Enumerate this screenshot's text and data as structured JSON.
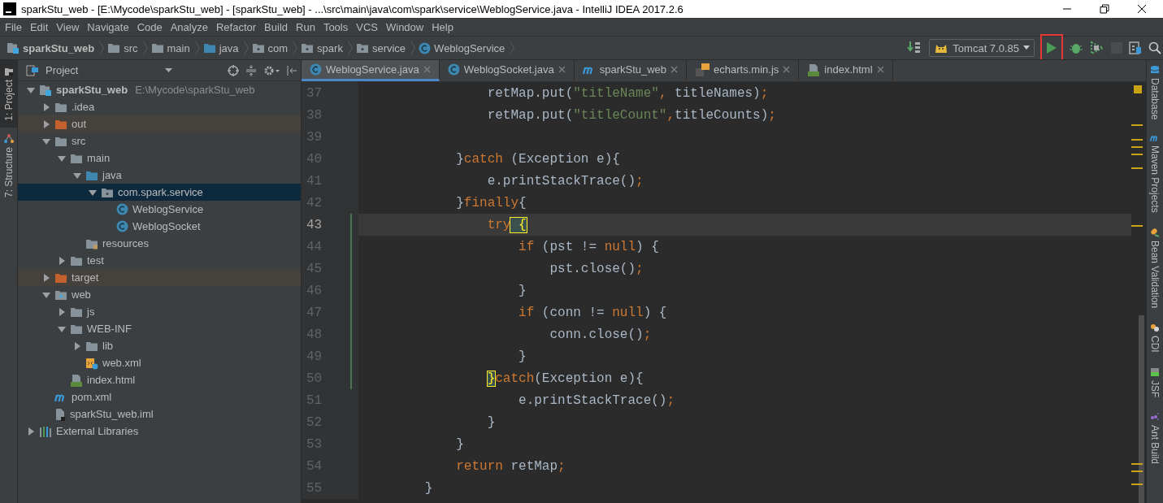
{
  "window": {
    "title": "sparkStu_web - [E:\\Mycode\\sparkStu_web] - [sparkStu_web] - ...\\src\\main\\java\\com\\spark\\service\\WeblogService.java - IntelliJ IDEA 2017.2.6"
  },
  "menu": [
    "File",
    "Edit",
    "View",
    "Navigate",
    "Code",
    "Analyze",
    "Refactor",
    "Build",
    "Run",
    "Tools",
    "VCS",
    "Window",
    "Help"
  ],
  "breadcrumbs": [
    {
      "kind": "module",
      "label": "sparkStu_web"
    },
    {
      "kind": "folder",
      "label": "src"
    },
    {
      "kind": "folder",
      "label": "main"
    },
    {
      "kind": "source",
      "label": "java"
    },
    {
      "kind": "package",
      "label": "com"
    },
    {
      "kind": "package",
      "label": "spark"
    },
    {
      "kind": "package",
      "label": "service"
    },
    {
      "kind": "class",
      "label": "WeblogService"
    }
  ],
  "toolbar": [
    {
      "kind": "update",
      "highlighted": false,
      "disabled": false
    },
    {
      "kind": "config",
      "label": "Tomcat 7.0.85",
      "highlighted": false,
      "disabled": false
    },
    {
      "kind": "run",
      "highlighted": true,
      "disabled": false
    },
    {
      "kind": "debug",
      "highlighted": false,
      "disabled": false
    },
    {
      "kind": "coverage",
      "highlighted": false,
      "disabled": false
    },
    {
      "kind": "stop",
      "highlighted": false,
      "disabled": true
    },
    {
      "kind": "project-structure",
      "highlighted": false,
      "disabled": false
    },
    {
      "kind": "search",
      "highlighted": false,
      "disabled": false
    }
  ],
  "left_tool_windows": [
    {
      "label": "1: Project",
      "selected": true,
      "kind": "project"
    },
    {
      "label": "7: Structure",
      "selected": false,
      "kind": "structure"
    }
  ],
  "project_panel": {
    "title": "Project",
    "tree": [
      {
        "kind": "module",
        "label": "sparkStu_web",
        "path": "E:\\Mycode\\sparkStu_web",
        "expanded": true,
        "selected": false,
        "children": [
          {
            "kind": "folder",
            "label": ".idea",
            "expanded": false,
            "selected": false
          },
          {
            "kind": "excluded",
            "label": "out",
            "expanded": false,
            "selected": false
          },
          {
            "kind": "folder",
            "label": "src",
            "expanded": true,
            "selected": false,
            "children": [
              {
                "kind": "folder",
                "label": "main",
                "expanded": true,
                "selected": false,
                "children": [
                  {
                    "kind": "source",
                    "label": "java",
                    "expanded": true,
                    "selected": false,
                    "children": [
                      {
                        "kind": "package",
                        "label": "com.spark.service",
                        "expanded": true,
                        "selected": true,
                        "children": [
                          {
                            "kind": "class",
                            "label": "WeblogService",
                            "selected": false
                          },
                          {
                            "kind": "class",
                            "label": "WeblogSocket",
                            "selected": false
                          }
                        ]
                      }
                    ]
                  },
                  {
                    "kind": "resources",
                    "label": "resources",
                    "selected": false
                  }
                ]
              },
              {
                "kind": "folder",
                "label": "test",
                "expanded": false,
                "selected": false
              }
            ]
          },
          {
            "kind": "excluded",
            "label": "target",
            "expanded": false,
            "selected": false
          },
          {
            "kind": "web",
            "label": "web",
            "expanded": true,
            "selected": false,
            "children": [
              {
                "kind": "folder",
                "label": "js",
                "expanded": false,
                "selected": false
              },
              {
                "kind": "folder",
                "label": "WEB-INF",
                "expanded": true,
                "selected": false,
                "children": [
                  {
                    "kind": "folder",
                    "label": "lib",
                    "expanded": false,
                    "selected": false
                  },
                  {
                    "kind": "xml",
                    "label": "web.xml",
                    "selected": false
                  }
                ]
              },
              {
                "kind": "html",
                "label": "index.html",
                "selected": false
              }
            ]
          },
          {
            "kind": "maven",
            "label": "pom.xml",
            "selected": false
          },
          {
            "kind": "iml",
            "label": "sparkStu_web.iml",
            "selected": false
          }
        ]
      },
      {
        "kind": "libraries",
        "label": "External Libraries",
        "expanded": false,
        "selected": false
      }
    ]
  },
  "tabs": [
    {
      "kind": "class",
      "label": "WeblogService.java",
      "selected": true
    },
    {
      "kind": "class",
      "label": "WeblogSocket.java",
      "selected": false
    },
    {
      "kind": "maven",
      "label": "sparkStu_web",
      "selected": false
    },
    {
      "kind": "js",
      "label": "echarts.min.js",
      "selected": false
    },
    {
      "kind": "html",
      "label": "index.html",
      "selected": false
    }
  ],
  "code": [
    {
      "number": "37",
      "current": false,
      "changed": false,
      "tokens": [
        {
          "kind": "plain",
          "text": "retMap.put("
        },
        {
          "kind": "string",
          "text": "\"titleName\""
        },
        {
          "kind": "punct",
          "text": ", "
        },
        {
          "kind": "plain",
          "text": "titleNames)"
        },
        {
          "kind": "punct",
          "text": ";"
        }
      ]
    },
    {
      "number": "38",
      "current": false,
      "changed": false,
      "tokens": [
        {
          "kind": "plain",
          "text": "retMap.put("
        },
        {
          "kind": "string",
          "text": "\"titleCount\""
        },
        {
          "kind": "punct",
          "text": ","
        },
        {
          "kind": "plain",
          "text": "titleCounts)"
        },
        {
          "kind": "punct",
          "text": ";"
        }
      ]
    },
    {
      "number": "39",
      "current": false,
      "changed": false
    },
    {
      "number": "40",
      "current": false,
      "changed": false,
      "tokens": [
        {
          "kind": "plain",
          "text": "}"
        },
        {
          "kind": "keyword",
          "text": "catch"
        },
        {
          "kind": "plain",
          "text": " (Exception e){"
        }
      ]
    },
    {
      "number": "41",
      "current": false,
      "changed": false,
      "tokens": [
        {
          "kind": "plain",
          "text": "e.printStackTrace()"
        },
        {
          "kind": "punct",
          "text": ";"
        }
      ]
    },
    {
      "number": "42",
      "current": false,
      "changed": false,
      "tokens": [
        {
          "kind": "plain",
          "text": "}"
        },
        {
          "kind": "keyword",
          "text": "finally"
        },
        {
          "kind": "plain",
          "text": "{"
        }
      ]
    },
    {
      "number": "43",
      "current": true,
      "changed": true,
      "tokens": [
        {
          "kind": "keyword",
          "text": "try"
        },
        {
          "kind": "match",
          "text": " {"
        }
      ]
    },
    {
      "number": "44",
      "current": false,
      "changed": true,
      "tokens": [
        {
          "kind": "keyword",
          "text": "if"
        },
        {
          "kind": "plain",
          "text": " (pst != "
        },
        {
          "kind": "keyword",
          "text": "null"
        },
        {
          "kind": "plain",
          "text": ") {"
        }
      ]
    },
    {
      "number": "45",
      "current": false,
      "changed": true,
      "tokens": [
        {
          "kind": "plain",
          "text": "pst.close()"
        },
        {
          "kind": "punct",
          "text": ";"
        }
      ]
    },
    {
      "number": "46",
      "current": false,
      "changed": true,
      "tokens": [
        {
          "kind": "plain",
          "text": "}"
        }
      ]
    },
    {
      "number": "47",
      "current": false,
      "changed": true,
      "tokens": [
        {
          "kind": "keyword",
          "text": "if"
        },
        {
          "kind": "plain",
          "text": " (conn != "
        },
        {
          "kind": "keyword",
          "text": "null"
        },
        {
          "kind": "plain",
          "text": ") {"
        }
      ]
    },
    {
      "number": "48",
      "current": false,
      "changed": true,
      "tokens": [
        {
          "kind": "plain",
          "text": "conn.close()"
        },
        {
          "kind": "punct",
          "text": ";"
        }
      ]
    },
    {
      "number": "49",
      "current": false,
      "changed": true,
      "tokens": [
        {
          "kind": "plain",
          "text": "}"
        }
      ]
    },
    {
      "number": "50",
      "current": false,
      "changed": true,
      "tokens": [
        {
          "kind": "match",
          "text": "}"
        },
        {
          "kind": "keyword",
          "text": "catch"
        },
        {
          "kind": "plain",
          "text": "(Exception e){"
        }
      ]
    },
    {
      "number": "51",
      "current": false,
      "changed": false,
      "tokens": [
        {
          "kind": "plain",
          "text": "e.printStackTrace()"
        },
        {
          "kind": "punct",
          "text": ";"
        }
      ]
    },
    {
      "number": "52",
      "current": false,
      "changed": false,
      "tokens": [
        {
          "kind": "plain",
          "text": "}"
        }
      ]
    },
    {
      "number": "53",
      "current": false,
      "changed": false,
      "tokens": [
        {
          "kind": "plain",
          "text": "}"
        }
      ]
    },
    {
      "number": "54",
      "current": false,
      "changed": false,
      "tokens": [
        {
          "kind": "keyword",
          "text": "return"
        },
        {
          "kind": "plain",
          "text": " retMap"
        },
        {
          "kind": "punct",
          "text": ";"
        }
      ]
    },
    {
      "number": "55",
      "current": false,
      "changed": false,
      "tokens": [
        {
          "kind": "plain",
          "text": "}"
        }
      ]
    }
  ],
  "right_tool_windows": [
    {
      "label": "Database",
      "kind": "database",
      "selected": false
    },
    {
      "label": "Maven Projects",
      "kind": "maven",
      "selected": false
    },
    {
      "label": "Bean Validation",
      "kind": "bean",
      "selected": false
    },
    {
      "label": "CDI",
      "kind": "cdi",
      "selected": false
    },
    {
      "label": "JSF",
      "kind": "jsf",
      "selected": false
    },
    {
      "label": "Ant Build",
      "kind": "ant",
      "selected": false
    }
  ]
}
